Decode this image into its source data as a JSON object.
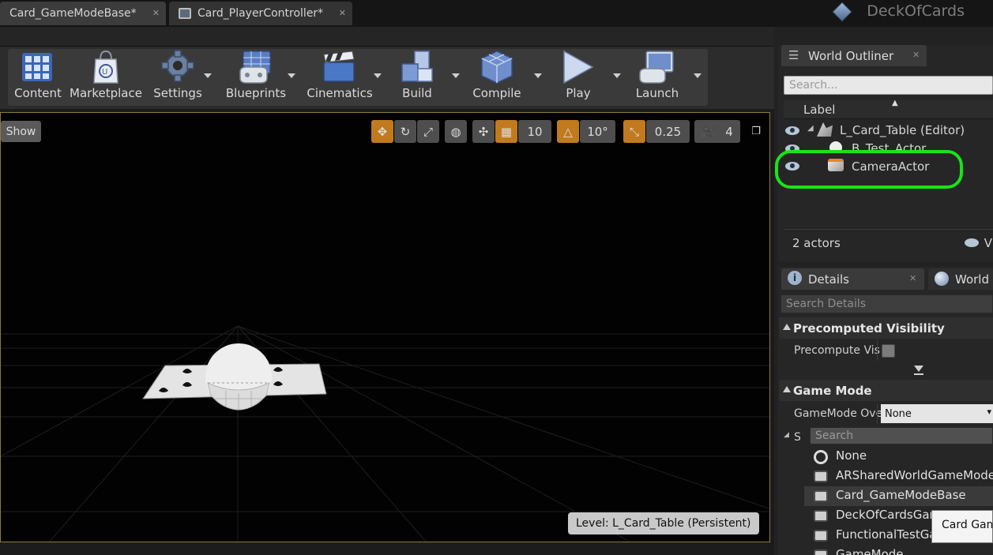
{
  "tabs": [
    {
      "label": "Card_GameModeBase*"
    },
    {
      "label": "Card_PlayerController*"
    }
  ],
  "project": {
    "name": "DeckOfCards"
  },
  "toolbar": {
    "content": "Content",
    "marketplace": "Marketplace",
    "settings": "Settings",
    "blueprints": "Blueprints",
    "cinematics": "Cinematics",
    "build": "Build",
    "compile": "Compile",
    "play": "Play",
    "launch": "Launch"
  },
  "viewport": {
    "show": "Show",
    "grid_snap": "10",
    "rotation_snap": "10°",
    "scale_snap": "0.25",
    "camera_speed": "4",
    "level_label": "Level:  L_Card_Table (Persistent)"
  },
  "outliner": {
    "tab": "World Outliner",
    "search_placeholder": "Search...",
    "label_column": "Label",
    "rows": [
      {
        "label": "L_Card_Table (Editor)"
      },
      {
        "label": "B_Test_Actor"
      },
      {
        "label": "CameraActor"
      }
    ],
    "actors_count": "2 actors",
    "view_options": "V"
  },
  "details": {
    "tab": "Details",
    "world_settings_tab": "World S",
    "search_placeholder": "Search Details",
    "precomputed_visibility": {
      "header": "Precomputed Visibility",
      "precompute_label": "Precompute Vis"
    },
    "game_mode": {
      "header": "Game Mode",
      "override_label": "GameMode Ove",
      "override_value": "None",
      "selected_label": "S",
      "search_placeholder": "Search",
      "options": [
        {
          "label": "None"
        },
        {
          "label": "ARSharedWorldGameMode"
        },
        {
          "label": "Card_GameModeBase"
        },
        {
          "label": "DeckOfCardsGam"
        },
        {
          "label": "FunctionalTestGa"
        },
        {
          "label": "GameMode"
        }
      ],
      "tooltip": "Card Gam"
    }
  },
  "colors": {
    "highlight": "#19e31a",
    "snap_active": "#c27a1e",
    "viewport_border": "#8d7a3a"
  }
}
